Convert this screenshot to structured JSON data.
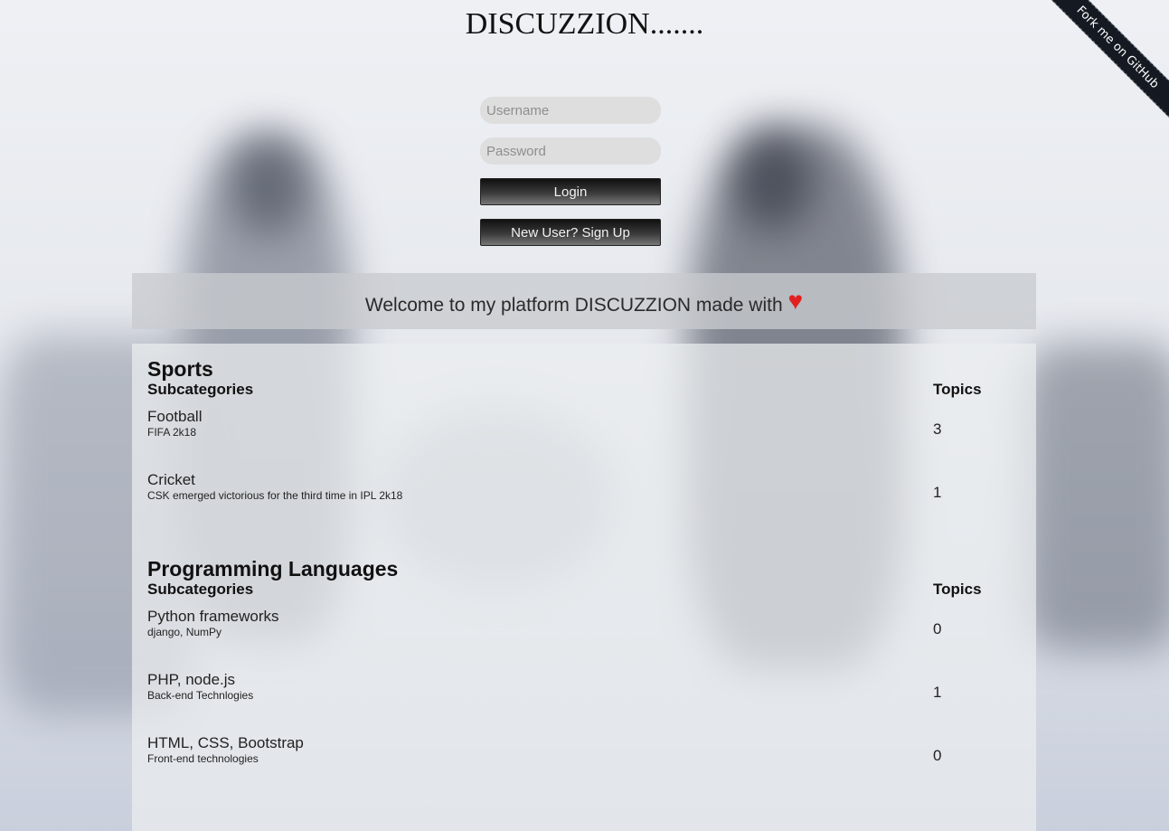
{
  "site_title": "DISCUZZION.......",
  "github_ribbon": "Fork me on GitHub",
  "login": {
    "username_placeholder": "Username",
    "password_placeholder": "Password",
    "login_label": "Login",
    "signup_label": "New User? Sign Up"
  },
  "welcome": {
    "text": "Welcome to my platform DISCUZZION made with",
    "heart": "♥"
  },
  "categories": [
    {
      "name": "Sports",
      "subcategories_header": "Subcategories",
      "topics_header": "Topics",
      "items": [
        {
          "name": "Football",
          "description": "FIFA 2k18",
          "topics": "3"
        },
        {
          "name": "Cricket",
          "description": "CSK emerged victorious for the third time in IPL 2k18",
          "topics": "1"
        }
      ]
    },
    {
      "name": "Programming Languages",
      "subcategories_header": "Subcategories",
      "topics_header": "Topics",
      "items": [
        {
          "name": "Python frameworks",
          "description": "django, NumPy",
          "topics": "0"
        },
        {
          "name": "PHP, node.js",
          "description": "Back-end Technlogies",
          "topics": "1"
        },
        {
          "name": "HTML, CSS, Bootstrap",
          "description": "Front-end technologies",
          "topics": "0"
        }
      ]
    }
  ]
}
